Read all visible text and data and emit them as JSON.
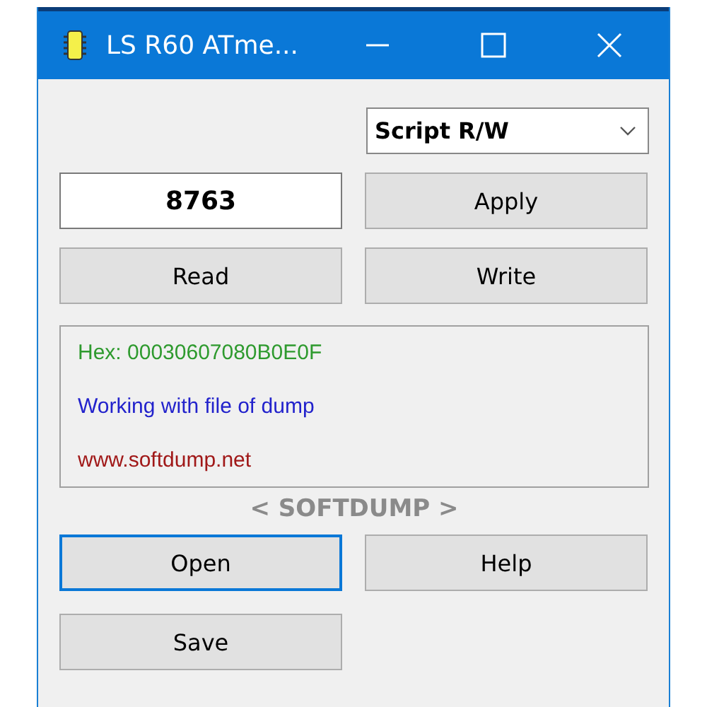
{
  "window": {
    "title": "LS R60 ATme..."
  },
  "mode_dropdown": {
    "value": "Script R/W"
  },
  "code_field": {
    "value": "8763"
  },
  "buttons_top": [
    {
      "label": "Apply",
      "focused": false
    }
  ],
  "buttons_mid": [
    {
      "label": "Read",
      "focused": false
    },
    {
      "label": "Write",
      "focused": false
    }
  ],
  "log": [
    {
      "kind": "hex",
      "text": "Hex: 00030607080B0E0F"
    },
    {
      "kind": "info",
      "text": "Working with file of dump"
    },
    {
      "kind": "link",
      "text": "www.softdump.net"
    }
  ],
  "brand": "< SOFTDUMP >",
  "buttons_bottom": [
    {
      "label": "Open",
      "focused": true
    },
    {
      "label": "Help",
      "focused": false
    },
    {
      "label": "Save",
      "focused": false
    }
  ]
}
